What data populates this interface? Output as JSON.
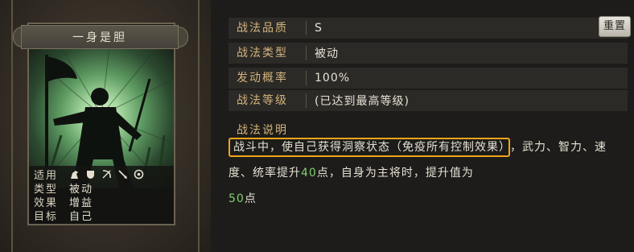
{
  "card": {
    "title": "一身是胆",
    "info": [
      {
        "key": "适用",
        "value": ""
      },
      {
        "key": "类型",
        "value": "被动"
      },
      {
        "key": "效果",
        "value": "增益"
      },
      {
        "key": "目标",
        "value": "自己"
      }
    ],
    "applicable_icons": [
      "cavalry-icon",
      "shield-icon",
      "bow-icon",
      "spear-icon",
      "gear-icon"
    ]
  },
  "details": {
    "quality_label": "战法品质",
    "quality_value": "S",
    "type_label": "战法类型",
    "type_value": "被动",
    "chance_label": "发动概率",
    "chance_value": "100%",
    "level_label": "战法等级",
    "level_value": "(已达到最高等级)",
    "reset_button": "重置",
    "desc_label": "战法说明",
    "desc_highlight": "战斗中，使自己获得洞察状态（免疫所有控制效果）",
    "desc_part1": "，武力、智力、速度、统率提升",
    "desc_num1": "40",
    "desc_part2": "点，自身为主将时，提升值为",
    "desc_num2": "50",
    "desc_part3": "点"
  },
  "colors": {
    "label_gold": "#d2b47c",
    "highlight_border": "#f0a519",
    "number_green": "#7fd06f"
  }
}
